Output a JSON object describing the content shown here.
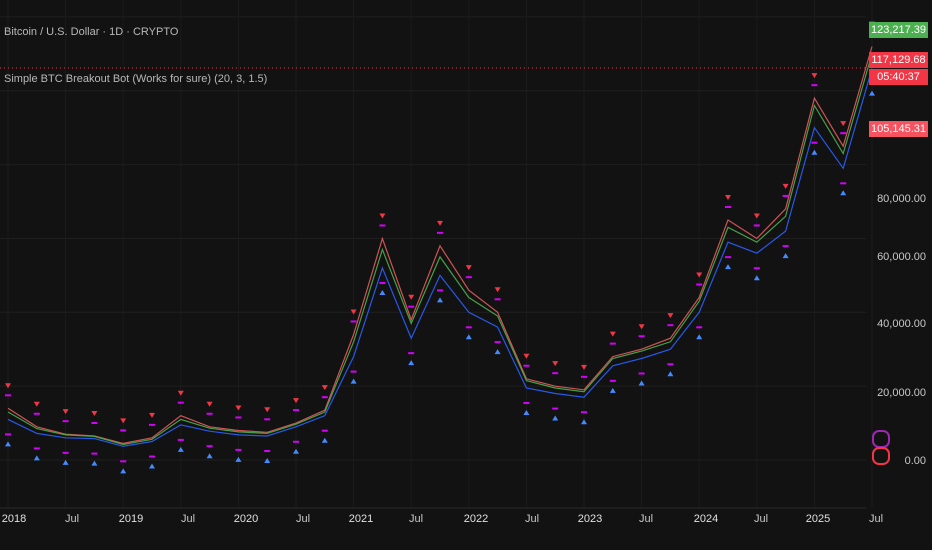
{
  "header": {
    "symbol": "Bitcoin / U.S. Dollar · 1D · CRYPTO",
    "indicator": "Simple BTC Breakout Bot (Works for sure) (20, 3, 1.5)"
  },
  "price_tags": [
    {
      "value": "123,217.39",
      "color": "#4caf50"
    },
    {
      "value": "117,129.68",
      "color": "#f23645"
    },
    {
      "value": "05:40:37",
      "color": "#f23645"
    },
    {
      "value": "105,145.31",
      "color": "#f7525f"
    }
  ],
  "icons": [
    "lightning-icon",
    "flag-icon"
  ],
  "chart_data": {
    "type": "line",
    "title": "Bitcoin / U.S. Dollar · 1D · CRYPTO",
    "ylim": [
      0,
      123500
    ],
    "y_tick_labels": [
      "0.00",
      "20,000.00",
      "40,000.00",
      "60,000.00",
      "80,000.00"
    ],
    "x_tick_labels": [
      "2018",
      "Jul",
      "2019",
      "Jul",
      "2020",
      "Jul",
      "2021",
      "Jul",
      "2022",
      "Jul",
      "2023",
      "Jul",
      "2024",
      "Jul",
      "2025",
      "Jul"
    ],
    "x": [
      "2018-01",
      "2018-04",
      "2018-07",
      "2018-10",
      "2019-01",
      "2019-04",
      "2019-07",
      "2019-10",
      "2020-01",
      "2020-04",
      "2020-07",
      "2020-10",
      "2021-01",
      "2021-04",
      "2021-07",
      "2021-10",
      "2022-01",
      "2022-04",
      "2022-07",
      "2022-10",
      "2023-01",
      "2023-04",
      "2023-07",
      "2023-10",
      "2024-01",
      "2024-04",
      "2024-07",
      "2024-10",
      "2025-01",
      "2025-04",
      "2025-07"
    ],
    "series": [
      {
        "color": "#e65c5c",
        "values": [
          14000,
          9000,
          7000,
          6500,
          4500,
          6000,
          12000,
          9000,
          8000,
          7500,
          10000,
          13500,
          34000,
          60000,
          38000,
          58000,
          46000,
          40000,
          22000,
          20000,
          19000,
          28000,
          30000,
          33000,
          44000,
          65000,
          60000,
          68000,
          98000,
          85000,
          112000
        ]
      },
      {
        "color": "#4caf50",
        "values": [
          13000,
          8500,
          6800,
          6400,
          4200,
          5600,
          11000,
          8600,
          7600,
          7200,
          9700,
          13000,
          32000,
          57000,
          37000,
          55000,
          44000,
          39000,
          21500,
          19500,
          18500,
          27500,
          29500,
          32000,
          43000,
          63000,
          59000,
          66000,
          96000,
          83000,
          110000
        ]
      },
      {
        "color": "#2962ff",
        "values": [
          11000,
          7200,
          6000,
          5800,
          3700,
          5000,
          9500,
          7800,
          6800,
          6500,
          9000,
          12000,
          28000,
          52000,
          33000,
          50000,
          40000,
          36000,
          19500,
          18000,
          17000,
          25500,
          27500,
          30000,
          40000,
          59000,
          56000,
          62000,
          90000,
          79000,
          106000
        ]
      }
    ]
  }
}
